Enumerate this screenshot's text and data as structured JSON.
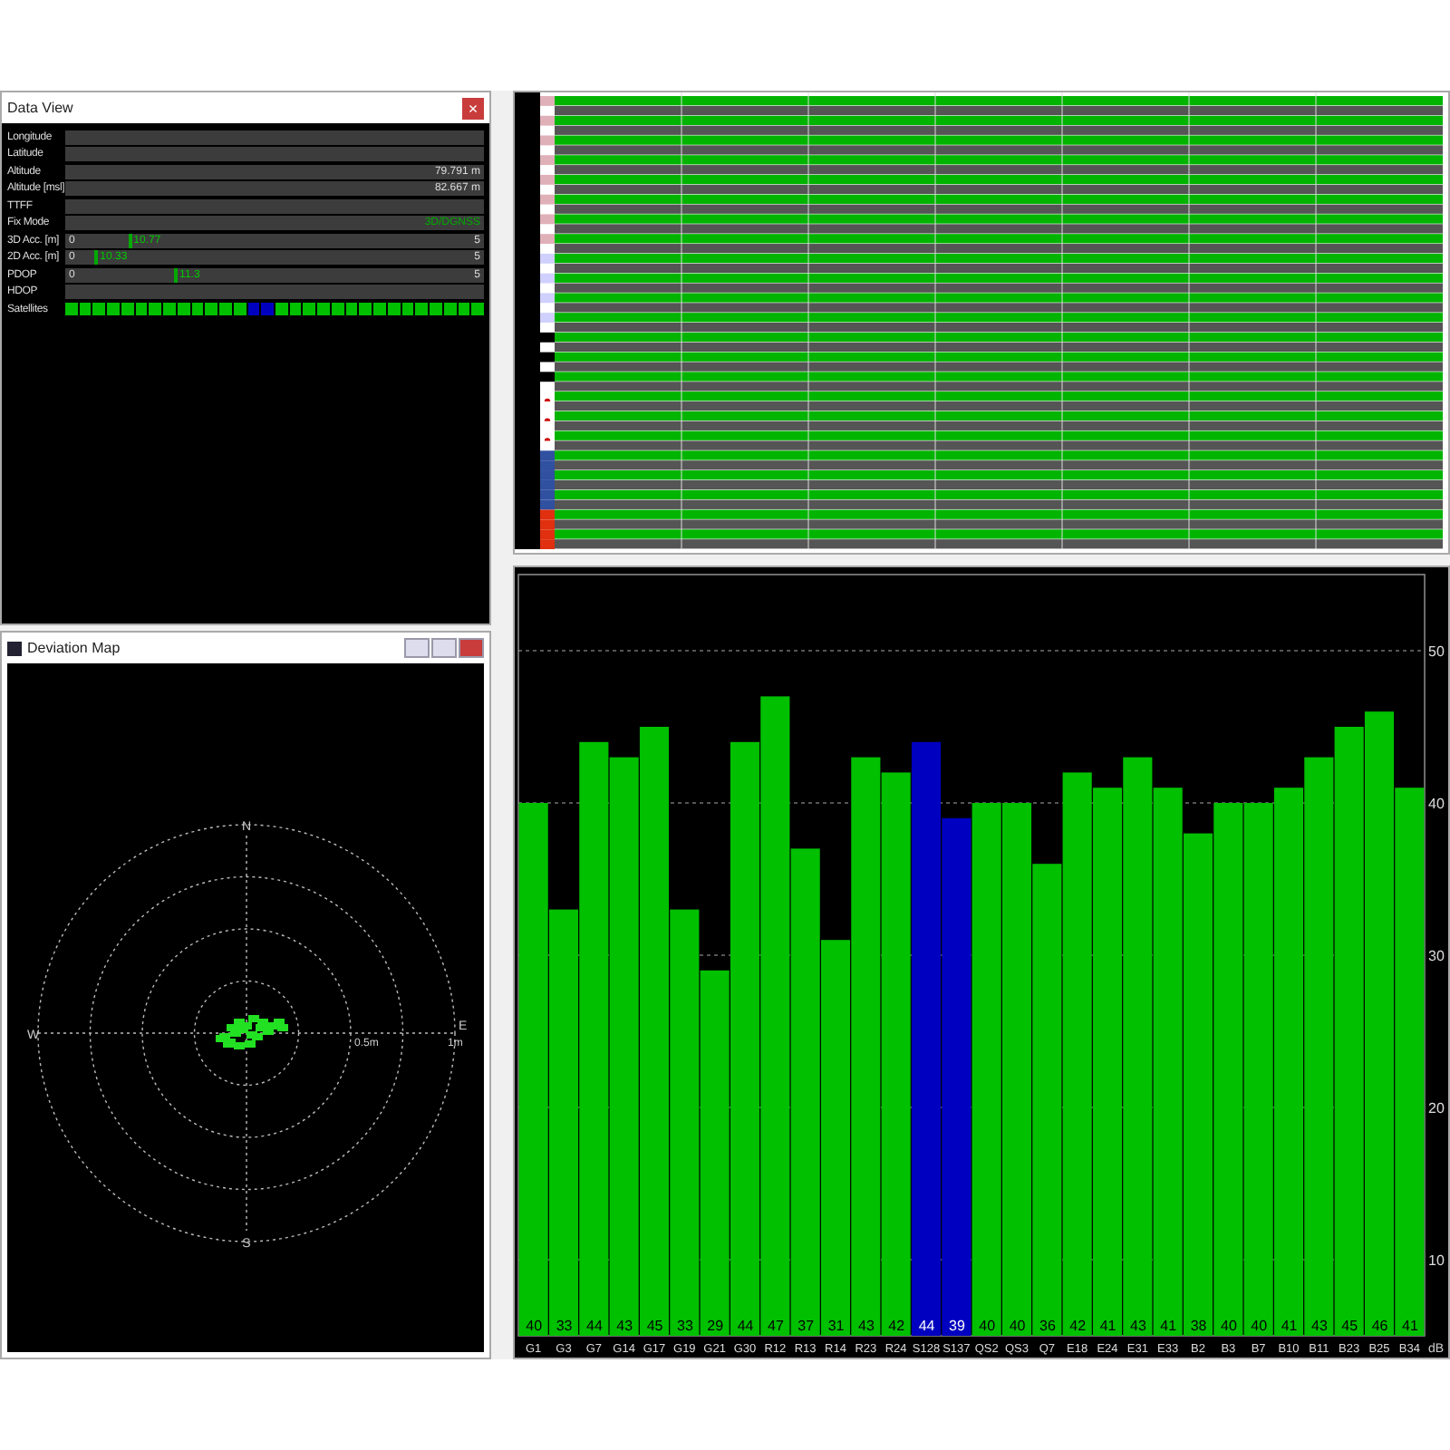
{
  "data_view": {
    "title": "Data View",
    "close": "×",
    "rows": [
      {
        "label": "Longitude",
        "kind": "blank"
      },
      {
        "label": "Latitude",
        "kind": "blank"
      },
      {
        "label": "Altitude",
        "kind": "value",
        "value": "79.791 m"
      },
      {
        "label": "Altitude [msl]",
        "kind": "value",
        "value": "82.667 m"
      },
      {
        "label": "TTFF",
        "kind": "blank"
      },
      {
        "label": "Fix Mode",
        "kind": "status",
        "value": "3D/DGNSS"
      },
      {
        "label": "3D Acc. [m]",
        "kind": "gauge",
        "min": "0",
        "marker": "10.77",
        "max": "5",
        "level": 0.15
      },
      {
        "label": "2D Acc. [m]",
        "kind": "gauge",
        "min": "0",
        "marker": "10.33",
        "max": "5",
        "level": 0.07
      },
      {
        "label": "PDOP",
        "kind": "gauge",
        "min": "0",
        "marker": "11.3",
        "max": "5",
        "level": 0.26
      },
      {
        "label": "HDOP",
        "kind": "blank"
      },
      {
        "label": "Satellites",
        "kind": "satellites"
      }
    ],
    "satellites": [
      {
        "color": "#00c000"
      },
      {
        "color": "#00c000"
      },
      {
        "color": "#00c000"
      },
      {
        "color": "#00c000"
      },
      {
        "color": "#00c000"
      },
      {
        "color": "#00c000"
      },
      {
        "color": "#00c000"
      },
      {
        "color": "#00c000"
      },
      {
        "color": "#00c000"
      },
      {
        "color": "#00c000"
      },
      {
        "color": "#00c000"
      },
      {
        "color": "#00c000"
      },
      {
        "color": "#00c000"
      },
      {
        "color": "#0000c0"
      },
      {
        "color": "#0000c0"
      },
      {
        "color": "#00c000"
      },
      {
        "color": "#00c000"
      },
      {
        "color": "#00c000"
      },
      {
        "color": "#00c000"
      },
      {
        "color": "#00c000"
      },
      {
        "color": "#00c000"
      },
      {
        "color": "#00c000"
      },
      {
        "color": "#00c000"
      },
      {
        "color": "#00c000"
      },
      {
        "color": "#00c000"
      },
      {
        "color": "#00c000"
      },
      {
        "color": "#00c000"
      },
      {
        "color": "#00c000"
      },
      {
        "color": "#00c000"
      },
      {
        "color": "#00c000"
      }
    ]
  },
  "deviation_map": {
    "title": "Deviation Map",
    "compass": {
      "north": "N",
      "south": "S",
      "east": "E",
      "west": "W"
    },
    "ring_labels": [
      "0.5m",
      "1m"
    ]
  },
  "signal_chart": {
    "unit": "dB",
    "chart_data": {
      "type": "bar",
      "categories": [
        "G1",
        "G3",
        "G7",
        "G14",
        "G17",
        "G19",
        "G21",
        "G30",
        "R12",
        "R13",
        "R14",
        "R23",
        "R24",
        "S128",
        "S137",
        "QS2",
        "QS3",
        "Q7",
        "E18",
        "E24",
        "E31",
        "E33",
        "B2",
        "B3",
        "B7",
        "B10",
        "B11",
        "B23",
        "B25",
        "B34"
      ],
      "series": [
        {
          "color": "#00c000",
          "values": [
            40,
            33,
            44,
            43,
            45,
            33,
            29,
            44,
            47,
            37,
            31,
            43,
            42,
            null,
            null,
            40,
            40,
            36,
            42,
            41,
            43,
            41,
            38,
            40,
            40,
            41,
            43,
            45,
            46,
            41
          ],
          "value_labels": [
            "40",
            "33",
            "44",
            "43",
            "45",
            "33",
            "29",
            "44",
            "47",
            "37",
            "31",
            "43",
            "42",
            null,
            null,
            "40",
            "40",
            "36",
            "42",
            "41",
            "43",
            "41",
            "38",
            "40",
            "40",
            "41",
            "43",
            "45",
            "46",
            "41"
          ]
        },
        {
          "color": "#0000c0",
          "values": [
            null,
            null,
            null,
            null,
            null,
            null,
            null,
            null,
            null,
            null,
            null,
            null,
            null,
            44,
            39,
            null,
            null,
            null,
            null,
            null,
            null,
            null,
            null,
            null,
            null,
            null,
            null,
            null,
            null,
            null
          ],
          "value_labels": [
            null,
            null,
            null,
            null,
            null,
            null,
            null,
            null,
            null,
            null,
            null,
            null,
            null,
            "44",
            "39",
            null,
            null,
            null,
            null,
            null,
            null,
            null,
            null,
            null,
            null,
            null,
            null,
            null,
            null,
            null
          ]
        }
      ],
      "ylim": [
        5,
        55
      ],
      "yticks": [
        10,
        20,
        30,
        40,
        50
      ],
      "grid": true,
      "stacked": false
    }
  }
}
